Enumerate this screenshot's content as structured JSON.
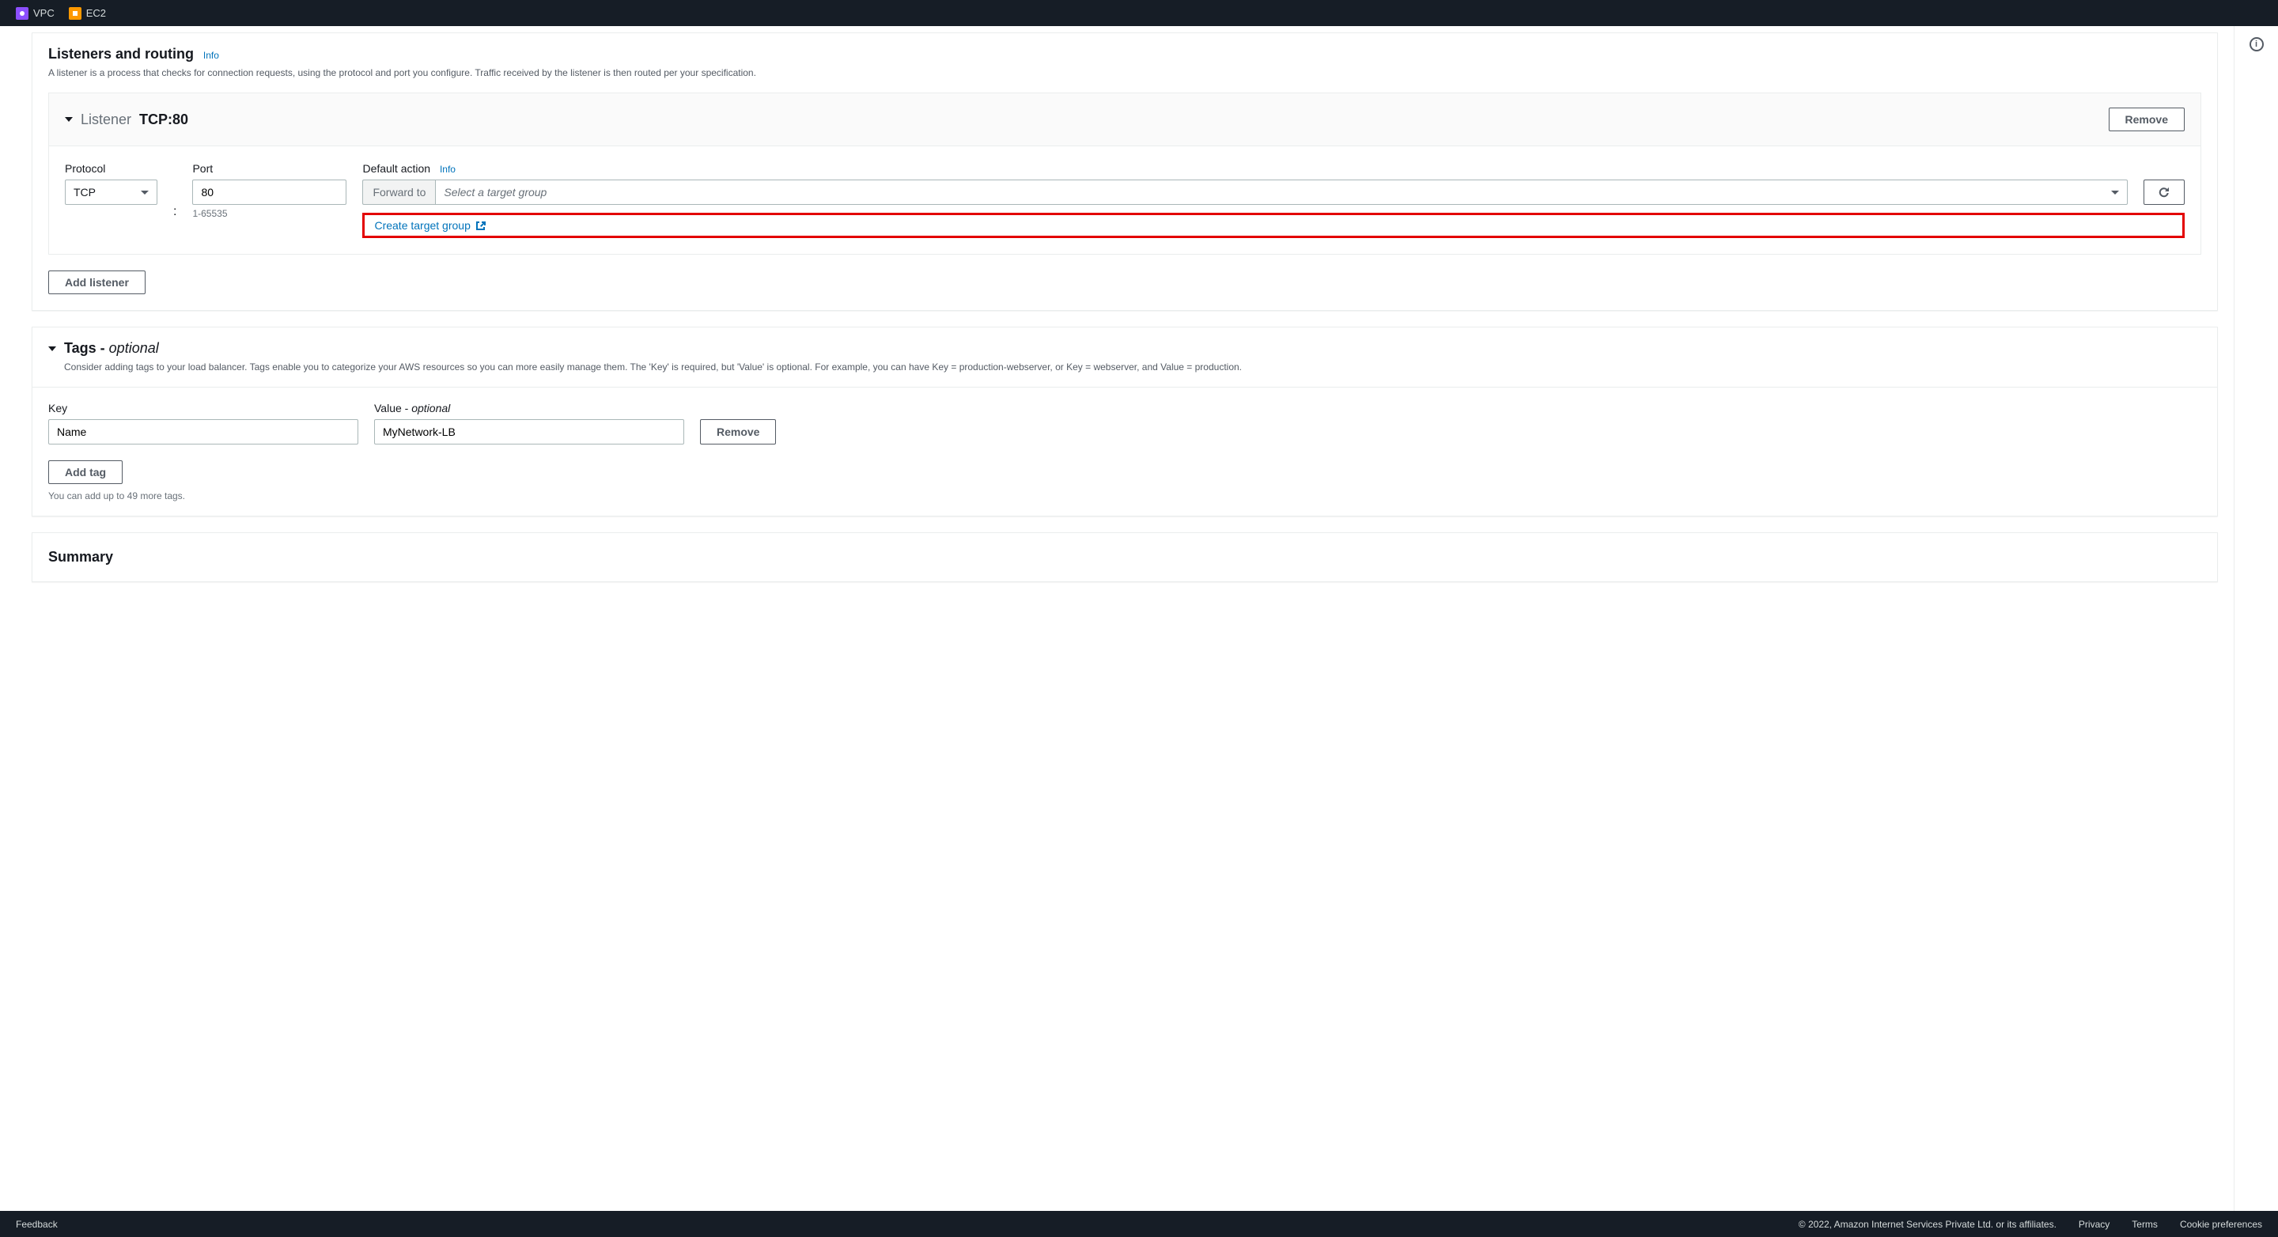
{
  "nav": {
    "items": [
      {
        "label": "VPC"
      },
      {
        "label": "EC2"
      }
    ]
  },
  "listeners": {
    "title": "Listeners and routing",
    "info": "Info",
    "desc": "A listener is a process that checks for connection requests, using the protocol and port you configure. Traffic received by the listener is then routed per your specification.",
    "listener": {
      "label": "Listener",
      "value": "TCP:80",
      "remove": "Remove"
    },
    "protocol": {
      "label": "Protocol",
      "value": "TCP"
    },
    "port": {
      "label": "Port",
      "value": "80",
      "hint": "1-65535"
    },
    "action": {
      "label": "Default action",
      "info": "Info",
      "forward": "Forward to",
      "placeholder": "Select a target group",
      "create": "Create target group"
    },
    "add": "Add listener"
  },
  "tags": {
    "title": "Tags - ",
    "optional": "optional",
    "desc": "Consider adding tags to your load balancer. Tags enable you to categorize your AWS resources so you can more easily manage them. The 'Key' is required, but 'Value' is optional. For example, you can have Key = production-webserver, or Key = webserver, and Value = production.",
    "key_label": "Key",
    "value_label": "Value - ",
    "value_optional": "optional",
    "key_value": "Name",
    "value_value": "MyNetwork-LB",
    "remove": "Remove",
    "add": "Add tag",
    "limit": "You can add up to 49 more tags."
  },
  "summary": {
    "title": "Summary"
  },
  "footer": {
    "feedback": "Feedback",
    "copyright": "© 2022, Amazon Internet Services Private Ltd. or its affiliates.",
    "privacy": "Privacy",
    "terms": "Terms",
    "cookies": "Cookie preferences"
  }
}
